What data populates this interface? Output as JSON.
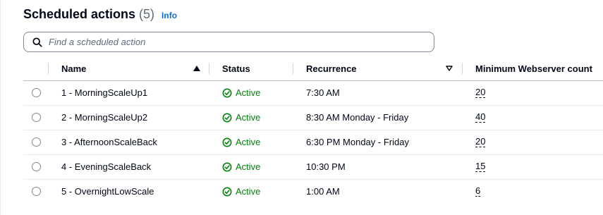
{
  "header": {
    "title": "Scheduled actions",
    "count": "(5)",
    "info_label": "Info"
  },
  "search": {
    "placeholder": "Find a scheduled action",
    "value": ""
  },
  "columns": {
    "name": "Name",
    "status": "Status",
    "recurrence": "Recurrence",
    "min_count": "Minimum Webserver count"
  },
  "sort": {
    "name": "ascending",
    "recurrence": "sortable"
  },
  "rows": [
    {
      "name": "1 - MorningScaleUp1",
      "status": "Active",
      "recurrence": "7:30 AM",
      "min_count": "20"
    },
    {
      "name": "2 - MorningScaleUp2",
      "status": "Active",
      "recurrence": "8:30 AM Monday - Friday",
      "min_count": "40"
    },
    {
      "name": "3 - AfternoonScaleBack",
      "status": "Active",
      "recurrence": "6:30 PM Monday - Friday",
      "min_count": "20"
    },
    {
      "name": "4 - EveningScaleBack",
      "status": "Active",
      "recurrence": "10:30 PM",
      "min_count": "15"
    },
    {
      "name": "5 - OvernightLowScale",
      "status": "Active",
      "recurrence": "1:00 AM",
      "min_count": "6"
    }
  ],
  "icons": {
    "search": "search-icon",
    "sort_ascending": "caret-up-filled-icon",
    "sort_unsorted": "caret-down-outline-icon",
    "status": "status-positive-icon"
  },
  "colors": {
    "active": "#037f0c",
    "link": "#0972d3",
    "text": "#000716",
    "border": "#7d8998"
  }
}
